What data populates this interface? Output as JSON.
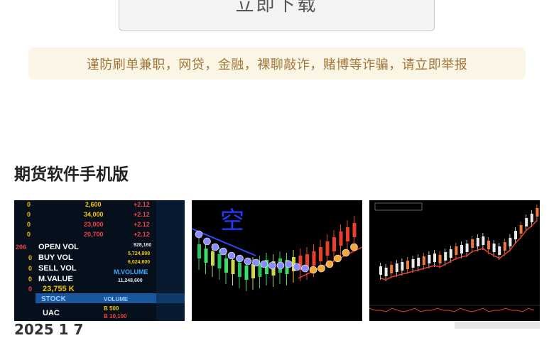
{
  "download_button": {
    "label": "立即下载"
  },
  "warning": {
    "text": "谨防刷单兼职，网贷，金融，裸聊敲诈，赌博等诈骗，请立即举报"
  },
  "section": {
    "title": "期货软件手机版"
  },
  "cards": [
    {
      "name": "stock-board",
      "top_numbers": [
        "2,600",
        "34,000",
        "23,000",
        "20,700"
      ],
      "changes": [
        "+2.12",
        "+2.12",
        "+2.12",
        "+2.12"
      ],
      "rows": [
        "OPEN VOL",
        "BUY VOL",
        "SELL VOL",
        "M.VALUE"
      ],
      "row_nums": [
        "206",
        "0",
        "0",
        "0"
      ],
      "right_vals": [
        "928,160",
        "5,724,898",
        "6,024,600",
        "11,248,600"
      ],
      "mvolume": "M.VOLUME",
      "big_value": "23,755 K",
      "stock": "STOCK",
      "volume": "VOLUME",
      "uac": "UAC",
      "b1": "B 500",
      "b2": "B 10,100"
    },
    {
      "name": "candlestick-dots",
      "overlay_char": "空"
    },
    {
      "name": "candlestick-uptrend"
    }
  ],
  "caption": {
    "text": "2025 1 7"
  },
  "colors": {
    "warning_bg": "#fbf5e6",
    "warning_text": "#a0773a",
    "up": "#e8402c",
    "down": "#27c35a"
  }
}
